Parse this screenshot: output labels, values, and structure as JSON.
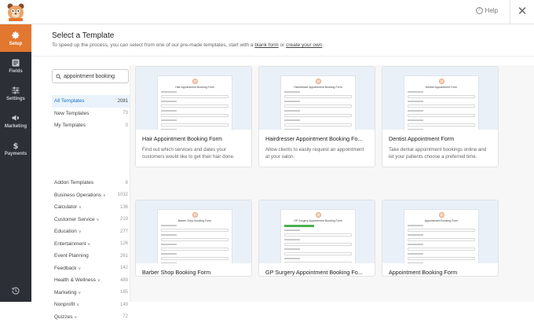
{
  "topbar": {
    "help_label": "Help"
  },
  "sidebar": {
    "items": [
      {
        "label": "Setup",
        "icon": "gear-icon",
        "active": true
      },
      {
        "label": "Fields",
        "icon": "fields-icon",
        "active": false
      },
      {
        "label": "Settings",
        "icon": "sliders-icon",
        "active": false
      },
      {
        "label": "Marketing",
        "icon": "megaphone-icon",
        "active": false
      },
      {
        "label": "Payments",
        "icon": "dollar-icon",
        "active": false
      }
    ]
  },
  "header": {
    "title": "Select a Template",
    "subtitle_prefix": "To speed up the process, you can select from one of our pre-made templates, start with a ",
    "blank_form_link": "blank form",
    "subtitle_mid": " or ",
    "create_own_link": "create your own",
    "subtitle_suffix": "."
  },
  "search": {
    "value": "appointment booking"
  },
  "categories_top": [
    {
      "label": "All Templates",
      "count": "2081",
      "selected": true
    },
    {
      "label": "New Templates",
      "count": "73",
      "selected": false
    },
    {
      "label": "My Templates",
      "count": "0",
      "selected": false
    }
  ],
  "categories": [
    {
      "label": "Addon Templates",
      "count": "8",
      "chevron": false
    },
    {
      "label": "Business Operations",
      "count": "1032",
      "chevron": true
    },
    {
      "label": "Calculator",
      "count": "136",
      "chevron": true
    },
    {
      "label": "Customer Service",
      "count": "219",
      "chevron": true
    },
    {
      "label": "Education",
      "count": "277",
      "chevron": true
    },
    {
      "label": "Entertainment",
      "count": "126",
      "chevron": true
    },
    {
      "label": "Event Planning",
      "count": "261",
      "chevron": false
    },
    {
      "label": "Feedback",
      "count": "142",
      "chevron": true
    },
    {
      "label": "Health & Wellness",
      "count": "489",
      "chevron": true
    },
    {
      "label": "Marketing",
      "count": "165",
      "chevron": true
    },
    {
      "label": "Nonprofit",
      "count": "149",
      "chevron": true
    },
    {
      "label": "Quizzes",
      "count": "72",
      "chevron": true
    }
  ],
  "templates": [
    {
      "title": "Hair Appointment Booking Form",
      "desc": "Find out which services and dates your customers would like to get their hair done.",
      "thumb_title": "Hair Appointment Booking Form"
    },
    {
      "title": "Hairdresser Appointment Booking Fo...",
      "desc": "Allow clients to easily request an appointment at your salon.",
      "thumb_title": "Hairdresser Appointment Booking Form"
    },
    {
      "title": "Dentist Appointment Form",
      "desc": "Take dental appointment bookings online and let your patients choose a preferred time.",
      "thumb_title": "Dentist Appointment Form"
    },
    {
      "title": "Barber Shop Booking Form",
      "desc": "",
      "thumb_title": "Barber Shop Booking Form"
    },
    {
      "title": "GP Surgery Appointment Booking Fo...",
      "desc": "",
      "thumb_title": "GP Surgery Appointment Booking Form"
    },
    {
      "title": "Appointment Booking Form",
      "desc": "",
      "thumb_title": "Appointment Booking Form"
    }
  ],
  "colors": {
    "accent": "#e27730",
    "sidebar_bg": "#2c2f36",
    "link_blue": "#1c72c4"
  }
}
